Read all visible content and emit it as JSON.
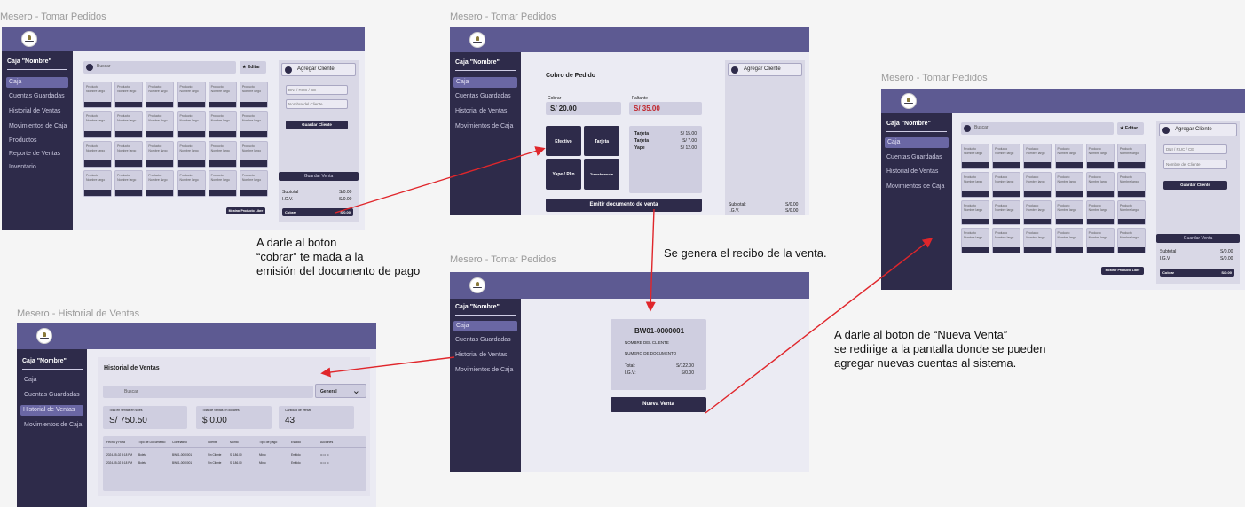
{
  "frames": {
    "f1": {
      "title": "Mesero -  Tomar Pedidos",
      "cash_title": "Caja \"Nombre\"",
      "menu": [
        "Caja",
        "Cuentas Guardadas",
        "Historial de Ventas",
        "Movimientos de Caja",
        "Productos",
        "Reporte de Ventas",
        "Inventario"
      ],
      "search_placeholder": "Buscar",
      "edit_label": "★ Editar",
      "add_client": "Agregar Cliente",
      "dni_placeholder": "DNI / RUC / CE",
      "name_placeholder": "Nombre del Cliente",
      "save_client": "Guardar Cliente",
      "save_sale": "Guardar Venta",
      "subtotal_label": "Subtotal",
      "subtotal_value": "S/0.00",
      "igv_label": "I.G.V.",
      "igv_value": "S/0.00",
      "charge_label": "Cobrar",
      "charge_value": "S/0.00",
      "show_products": "Mostrar Producto Libre"
    },
    "f2": {
      "title": "Mesero -  Tomar Pedidos",
      "cash_title": "Caja \"Nombre\"",
      "menu": [
        "Caja",
        "Cuentas Guardadas",
        "Historial de Ventas",
        "Movimientos de Caja"
      ],
      "heading": "Cobro de Pedido",
      "cobrar_label": "Cobrar",
      "cobrar_value": "S/ 20.00",
      "faltante_label": "Faltante",
      "faltante_value": "S/ 35.00",
      "methods": [
        "Efectivo",
        "Tarjeta",
        "Yape / Plin",
        "Transferencia"
      ],
      "payments": [
        {
          "method": "Tarjeta",
          "amount": "S/ 15.00"
        },
        {
          "method": "Tarjeta",
          "amount": "S/ 7.00"
        },
        {
          "method": "Yape",
          "amount": "S/ 12.00"
        }
      ],
      "emit": "Emitir documento de venta",
      "add_client": "Agregar Cliente",
      "subtotal_label": "Subtotal:",
      "subtotal_value": "S/0.00",
      "igv_label": "I.G.V.",
      "igv_value": "S/0.00"
    },
    "f3": {
      "title": "Mesero -  Tomar Pedidos",
      "cash_title": "Caja \"Nombre\"",
      "menu": [
        "Caja",
        "Cuentas Guardadas",
        "Historial de Ventas",
        "Movimientos de Caja"
      ],
      "receipt_code": "BW01-0000001",
      "client_name": "NOMBRE DEL CLIENTE",
      "doc_number": "NUMERO DE DOCUMENTO",
      "total_label": "Total:",
      "total_value": "S/122.00",
      "igv_label": "I.G.V:",
      "igv_value": "S/0.00",
      "new_sale": "Nueva Venta"
    },
    "f4": {
      "title": "Mesero -  Historial de Ventas",
      "cash_title": "Caja \"Nombre\"",
      "menu": [
        "Caja",
        "Cuentas Guardadas",
        "Historial de Ventas",
        "Movimientos de Caja"
      ],
      "heading": "Historial de Ventas",
      "search_placeholder": "Buscar",
      "filter": "General",
      "stats": [
        {
          "label": "Total en ventas en soles",
          "value": "S/ 750.50"
        },
        {
          "label": "Total de ventas en dollares",
          "value": "$ 0.00"
        },
        {
          "label": "Cantidad de ventas",
          "value": "43"
        }
      ],
      "columns": [
        "Fecha y Hora",
        "Tipo de Documento",
        "Correlativo",
        "Cliente",
        "Monto",
        "Tipo de pago",
        "Estado",
        "Acciones"
      ],
      "rows": [
        [
          "2024-05-02 3:18 PM",
          "Boleta",
          "BW01-0000001",
          "Sin Cliente",
          "S/ 186.00",
          "Mixto",
          "Emitido",
          "⊙ ⊡ ⊙"
        ],
        [
          "2024-05-02 3:18 PM",
          "Boleta",
          "BW01-0000001",
          "Sin Cliente",
          "S/ 186.00",
          "Mixto",
          "Emitido",
          "⊙ ⊡ ⊙"
        ]
      ]
    },
    "f5": {
      "title": "Mesero -  Tomar Pedidos",
      "cash_title": "Caja \"Nombre\"",
      "menu": [
        "Caja",
        "Cuentas Guardadas",
        "Historial de Ventas",
        "Movimientos de Caja"
      ],
      "search_placeholder": "Buscar",
      "edit_label": "★ Editar",
      "add_client": "Agregar Cliente",
      "dni_placeholder": "DNI / RUC / CE",
      "name_placeholder": "Nombre del Cliente",
      "save_client": "Guardar Cliente",
      "save_sale": "Guardar Venta",
      "subtotal_label": "Subtotal",
      "subtotal_value": "S/0.00",
      "igv_label": "I.G.V.",
      "igv_value": "S/0.00",
      "charge_label": "Cobrar",
      "charge_value": "S/0.00",
      "show_products": "Mostrar Producto Libre"
    }
  },
  "product_card": {
    "name": "Producto",
    "desc": "Nombre largo"
  },
  "annotations": {
    "a1": [
      "A darle al boton",
      "“cobrar” te mada a la",
      "emisión del documento de pago"
    ],
    "a2": "Se genera el recibo de la venta.",
    "a3": [
      "A darle al boton de “Nueva Venta”",
      "se redirige a la pantalla donde se pueden",
      "agregar nuevas cuentas al sistema."
    ]
  },
  "colors": {
    "topbar": "#5d5a92",
    "sidebar": "#2e2b4a",
    "arrow": "#e0262b",
    "faltante": "#c0242b"
  }
}
